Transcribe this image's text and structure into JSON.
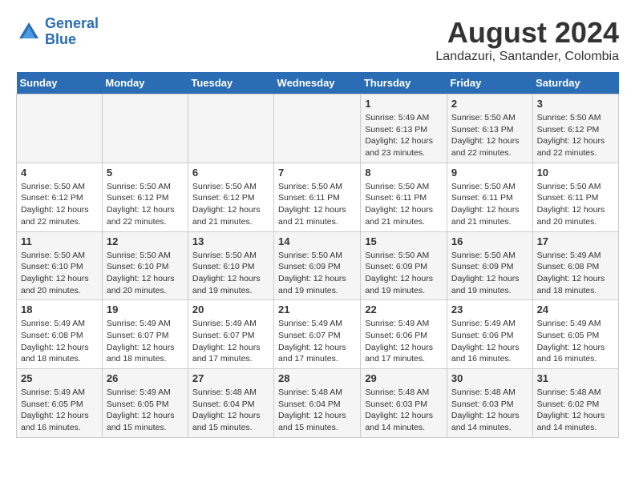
{
  "logo": {
    "line1": "General",
    "line2": "Blue"
  },
  "title": "August 2024",
  "subtitle": "Landazuri, Santander, Colombia",
  "days_of_week": [
    "Sunday",
    "Monday",
    "Tuesday",
    "Wednesday",
    "Thursday",
    "Friday",
    "Saturday"
  ],
  "weeks": [
    [
      {
        "day": "",
        "info": ""
      },
      {
        "day": "",
        "info": ""
      },
      {
        "day": "",
        "info": ""
      },
      {
        "day": "",
        "info": ""
      },
      {
        "day": "1",
        "info": "Sunrise: 5:49 AM\nSunset: 6:13 PM\nDaylight: 12 hours\nand 23 minutes."
      },
      {
        "day": "2",
        "info": "Sunrise: 5:50 AM\nSunset: 6:13 PM\nDaylight: 12 hours\nand 22 minutes."
      },
      {
        "day": "3",
        "info": "Sunrise: 5:50 AM\nSunset: 6:12 PM\nDaylight: 12 hours\nand 22 minutes."
      }
    ],
    [
      {
        "day": "4",
        "info": "Sunrise: 5:50 AM\nSunset: 6:12 PM\nDaylight: 12 hours\nand 22 minutes."
      },
      {
        "day": "5",
        "info": "Sunrise: 5:50 AM\nSunset: 6:12 PM\nDaylight: 12 hours\nand 22 minutes."
      },
      {
        "day": "6",
        "info": "Sunrise: 5:50 AM\nSunset: 6:12 PM\nDaylight: 12 hours\nand 21 minutes."
      },
      {
        "day": "7",
        "info": "Sunrise: 5:50 AM\nSunset: 6:11 PM\nDaylight: 12 hours\nand 21 minutes."
      },
      {
        "day": "8",
        "info": "Sunrise: 5:50 AM\nSunset: 6:11 PM\nDaylight: 12 hours\nand 21 minutes."
      },
      {
        "day": "9",
        "info": "Sunrise: 5:50 AM\nSunset: 6:11 PM\nDaylight: 12 hours\nand 21 minutes."
      },
      {
        "day": "10",
        "info": "Sunrise: 5:50 AM\nSunset: 6:11 PM\nDaylight: 12 hours\nand 20 minutes."
      }
    ],
    [
      {
        "day": "11",
        "info": "Sunrise: 5:50 AM\nSunset: 6:10 PM\nDaylight: 12 hours\nand 20 minutes."
      },
      {
        "day": "12",
        "info": "Sunrise: 5:50 AM\nSunset: 6:10 PM\nDaylight: 12 hours\nand 20 minutes."
      },
      {
        "day": "13",
        "info": "Sunrise: 5:50 AM\nSunset: 6:10 PM\nDaylight: 12 hours\nand 19 minutes."
      },
      {
        "day": "14",
        "info": "Sunrise: 5:50 AM\nSunset: 6:09 PM\nDaylight: 12 hours\nand 19 minutes."
      },
      {
        "day": "15",
        "info": "Sunrise: 5:50 AM\nSunset: 6:09 PM\nDaylight: 12 hours\nand 19 minutes."
      },
      {
        "day": "16",
        "info": "Sunrise: 5:50 AM\nSunset: 6:09 PM\nDaylight: 12 hours\nand 19 minutes."
      },
      {
        "day": "17",
        "info": "Sunrise: 5:49 AM\nSunset: 6:08 PM\nDaylight: 12 hours\nand 18 minutes."
      }
    ],
    [
      {
        "day": "18",
        "info": "Sunrise: 5:49 AM\nSunset: 6:08 PM\nDaylight: 12 hours\nand 18 minutes."
      },
      {
        "day": "19",
        "info": "Sunrise: 5:49 AM\nSunset: 6:07 PM\nDaylight: 12 hours\nand 18 minutes."
      },
      {
        "day": "20",
        "info": "Sunrise: 5:49 AM\nSunset: 6:07 PM\nDaylight: 12 hours\nand 17 minutes."
      },
      {
        "day": "21",
        "info": "Sunrise: 5:49 AM\nSunset: 6:07 PM\nDaylight: 12 hours\nand 17 minutes."
      },
      {
        "day": "22",
        "info": "Sunrise: 5:49 AM\nSunset: 6:06 PM\nDaylight: 12 hours\nand 17 minutes."
      },
      {
        "day": "23",
        "info": "Sunrise: 5:49 AM\nSunset: 6:06 PM\nDaylight: 12 hours\nand 16 minutes."
      },
      {
        "day": "24",
        "info": "Sunrise: 5:49 AM\nSunset: 6:05 PM\nDaylight: 12 hours\nand 16 minutes."
      }
    ],
    [
      {
        "day": "25",
        "info": "Sunrise: 5:49 AM\nSunset: 6:05 PM\nDaylight: 12 hours\nand 16 minutes."
      },
      {
        "day": "26",
        "info": "Sunrise: 5:49 AM\nSunset: 6:05 PM\nDaylight: 12 hours\nand 15 minutes."
      },
      {
        "day": "27",
        "info": "Sunrise: 5:48 AM\nSunset: 6:04 PM\nDaylight: 12 hours\nand 15 minutes."
      },
      {
        "day": "28",
        "info": "Sunrise: 5:48 AM\nSunset: 6:04 PM\nDaylight: 12 hours\nand 15 minutes."
      },
      {
        "day": "29",
        "info": "Sunrise: 5:48 AM\nSunset: 6:03 PM\nDaylight: 12 hours\nand 14 minutes."
      },
      {
        "day": "30",
        "info": "Sunrise: 5:48 AM\nSunset: 6:03 PM\nDaylight: 12 hours\nand 14 minutes."
      },
      {
        "day": "31",
        "info": "Sunrise: 5:48 AM\nSunset: 6:02 PM\nDaylight: 12 hours\nand 14 minutes."
      }
    ]
  ]
}
